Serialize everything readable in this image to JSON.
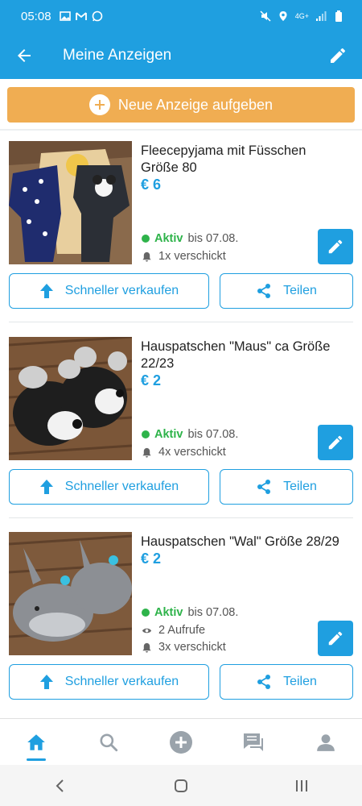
{
  "status_bar": {
    "time": "05:08",
    "network": "4G+"
  },
  "app_bar": {
    "title": "Meine Anzeigen"
  },
  "new_ad": {
    "label": "Neue Anzeige aufgeben"
  },
  "listings": [
    {
      "title": "Fleecepyjama mit Füsschen Größe 80",
      "price": "€ 6",
      "status": "Aktiv",
      "until": "bis 07.08.",
      "views": "",
      "sent": "1x verschickt"
    },
    {
      "title": "Hauspatschen \"Maus\" ca Größe 22/23",
      "price": "€ 2",
      "status": "Aktiv",
      "until": "bis 07.08.",
      "views": "",
      "sent": "4x verschickt"
    },
    {
      "title": "Hauspatschen \"Wal\" Größe 28/29",
      "price": "€ 2",
      "status": "Aktiv",
      "until": "bis 07.08.",
      "views": "2 Aufrufe",
      "sent": "3x verschickt"
    }
  ],
  "actions": {
    "sell_faster": "Schneller verkaufen",
    "share": "Teilen"
  },
  "colors": {
    "primary": "#1f9fe0",
    "accent": "#f0ad52",
    "active_green": "#2eb34a"
  },
  "bottom_nav": [
    "home-icon",
    "search-icon",
    "add-icon",
    "messages-icon",
    "profile-icon"
  ]
}
